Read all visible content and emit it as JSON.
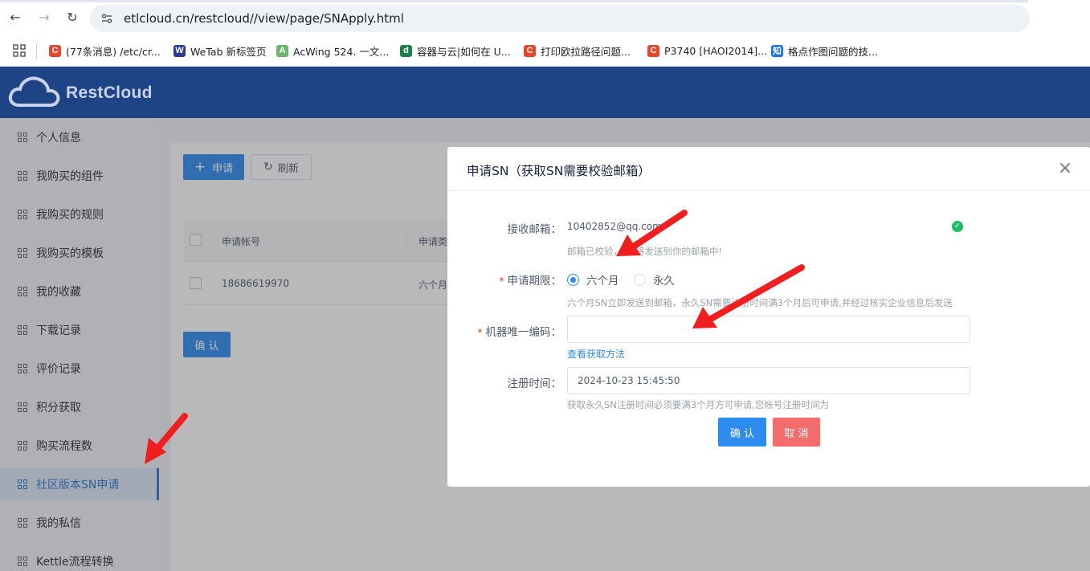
{
  "browser": {
    "url": "etlcloud.cn/restcloud//view/page/SNApply.html",
    "bookmarks": [
      {
        "label": "(77条消息) /etc/cr...",
        "fav": "C",
        "color": "#e8452c"
      },
      {
        "label": "WeTab 新标签页",
        "fav": "W",
        "color": "#2b3a8c"
      },
      {
        "label": "AcWing 524. 一文...",
        "fav": "A",
        "color": "#6db36b"
      },
      {
        "label": "容器与云|如何在 U...",
        "fav": "d",
        "color": "#1a7f4b"
      },
      {
        "label": "打印欧拉路径问题...",
        "fav": "C",
        "color": "#e8452c"
      },
      {
        "label": "P3740 [HAOI2014]...",
        "fav": "C",
        "color": "#e8452c"
      },
      {
        "label": "格点作图问题的技...",
        "fav": "知",
        "color": "#1772f6"
      }
    ]
  },
  "app": {
    "logo_text": "RestCloud",
    "header_color": "#1f4486"
  },
  "sidebar": {
    "items": [
      {
        "label": "个人信息"
      },
      {
        "label": "我购买的组件"
      },
      {
        "label": "我购买的规则"
      },
      {
        "label": "我购买的模板"
      },
      {
        "label": "我的收藏"
      },
      {
        "label": "下载记录"
      },
      {
        "label": "评价记录"
      },
      {
        "label": "积分获取"
      },
      {
        "label": "购买流程数"
      },
      {
        "label": "社区版本SN申请",
        "active": true
      },
      {
        "label": "我的私信"
      },
      {
        "label": "Kettle流程转换"
      }
    ]
  },
  "main": {
    "apply_button": "申请",
    "refresh_button": "刷新",
    "columns": [
      "申请帐号",
      "申请类"
    ],
    "rows": [
      {
        "account": "18686619970",
        "type": "六个月"
      }
    ],
    "confirm_button": "确 认"
  },
  "modal": {
    "title": "申请SN（获取SN需要校验邮箱）",
    "email_label": "接收邮箱：",
    "email_value": "10402852@qq.com",
    "email_hint": "邮箱已校验，SN将发送到你的邮箱中!",
    "period_label": "申请期限：",
    "period_options": [
      "六个月",
      "永久"
    ],
    "period_selected": "六个月",
    "period_hint": "六个月SN立即发送到邮箱，永久SN需要注册时间满3个月后可申请,并经过核实企业信息后发送",
    "machine_label": "机器唯一编码：",
    "machine_value": "",
    "machine_link": "查看获取方法",
    "regtime_label": "注册时间：",
    "regtime_value": "2024-10-23 15:45:50",
    "regtime_hint": "获取永久SN注册时间必须要满3个月方可申请,您帐号注册时间为",
    "confirm": "确 认",
    "cancel": "取 消"
  }
}
